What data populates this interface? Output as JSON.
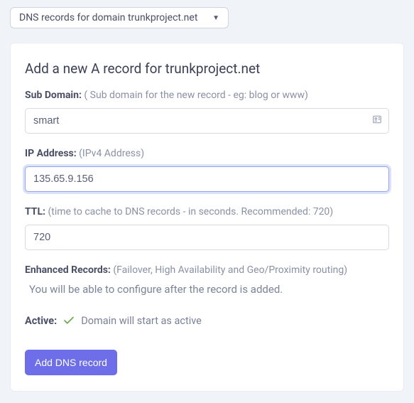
{
  "dropdown": {
    "label": "DNS records for domain trunkproject.net"
  },
  "card": {
    "title": "Add a new A record for trunkproject.net",
    "subdomain": {
      "label": "Sub Domain:",
      "hint": "( Sub domain for the new record - eg: blog or www)",
      "value": "smart"
    },
    "ip": {
      "label": "IP Address:",
      "hint": "(IPv4 Address)",
      "value": "135.65.9.156"
    },
    "ttl": {
      "label": "TTL:",
      "hint": "(time to cache to DNS records - in seconds. Recommended: 720)",
      "value": "720"
    },
    "enhanced": {
      "label": "Enhanced Records:",
      "hint": "(Failover, High Availability and Geo/Proximity routing)",
      "message": "You will be able to configure after the record is added."
    },
    "active": {
      "label": "Active:",
      "message": "Domain will start as active"
    },
    "submit_label": "Add DNS record"
  }
}
